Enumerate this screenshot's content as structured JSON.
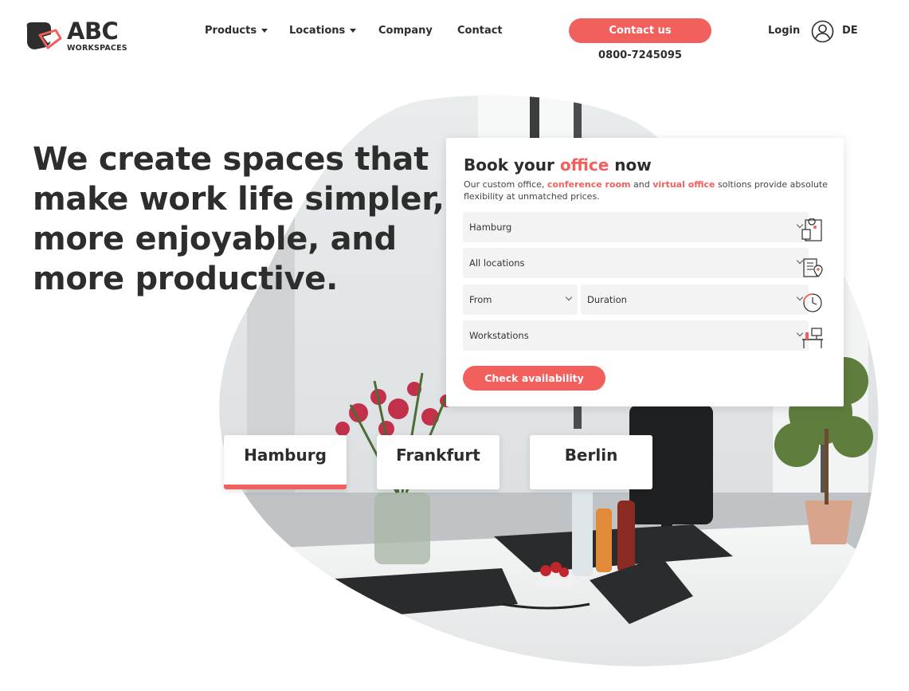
{
  "brand": {
    "name": "ABC",
    "sub": "WORKSPACES",
    "accent": "#f2605d",
    "text_color": "#2d2d2d"
  },
  "nav": {
    "products": "Products",
    "locations": "Locations",
    "company": "Company",
    "contact": "Contact"
  },
  "cta": {
    "label": "Contact us",
    "phone": "0800-7245095"
  },
  "account": {
    "login": "Login",
    "lang": "DE",
    "user_icon": "user-circle-icon"
  },
  "hero": {
    "headline": "We create spaces that make work life simpler, more enjoyable, and more productive."
  },
  "booking": {
    "title_pre": "Book your ",
    "title_hl": "office",
    "title_post": " now",
    "desc_1": "Our custom office, ",
    "desc_hl1": "conference room",
    "desc_2": " and ",
    "desc_hl2": "virtual office",
    "desc_3": " soltions provide absolute flexibility at unmatched prices.",
    "city": "Hamburg",
    "location": "All locations",
    "from": "From",
    "duration": "Duration",
    "workstations": "Workstations",
    "button": "Check availability",
    "icons": [
      "map-pin-screen-icon",
      "building-location-icon",
      "clock-timer-icon",
      "desk-workstation-icon"
    ]
  },
  "city_tabs": [
    {
      "label": "Hamburg",
      "active": true
    },
    {
      "label": "Frankfurt",
      "active": false
    },
    {
      "label": "Berlin",
      "active": false
    }
  ]
}
